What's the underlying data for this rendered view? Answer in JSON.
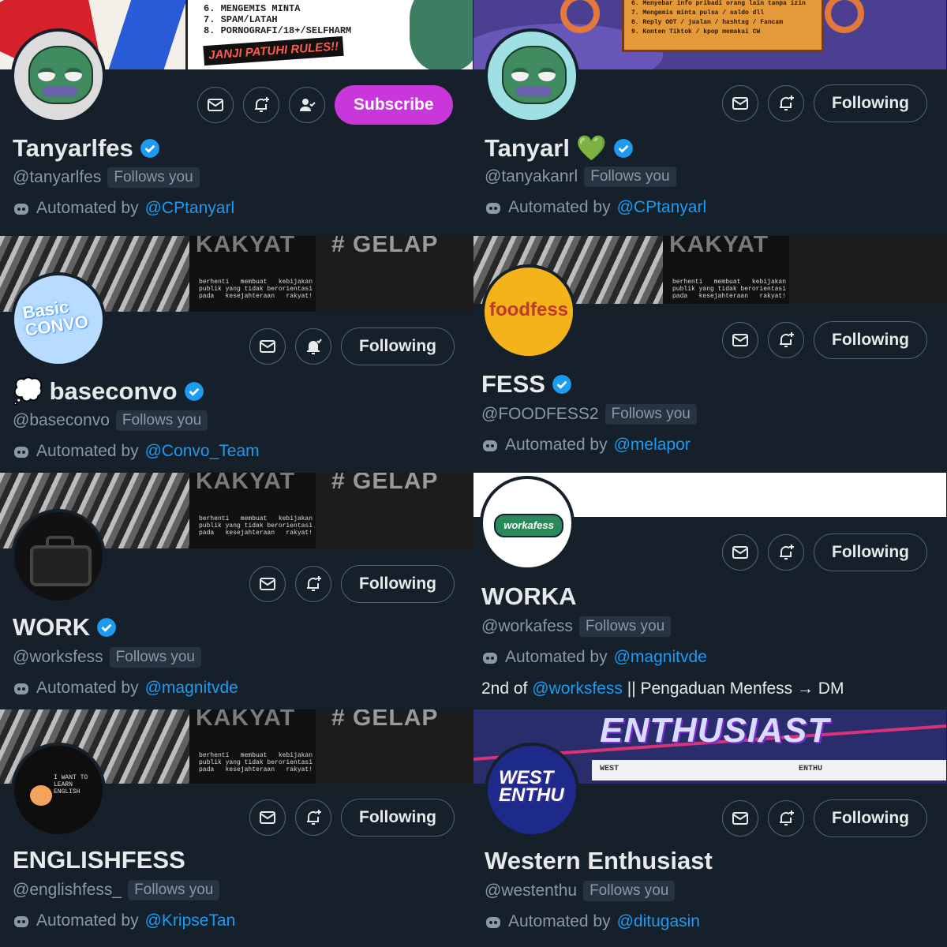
{
  "profiles": [
    {
      "display_name": "Tanyarlfes",
      "handle": "@tanyarlfes",
      "follows_you": "Follows you",
      "automated_prefix": "Automated by",
      "automated_by": "@CPtanyarl",
      "primary_button": "Subscribe",
      "verified": true
    },
    {
      "display_name": "Tanyarl",
      "name_emoji": "💚",
      "handle": "@tanyakanrl",
      "follows_you": "Follows you",
      "automated_prefix": "Automated by",
      "automated_by": "@CPtanyarl",
      "primary_button": "Following",
      "verified": true
    },
    {
      "display_name": "baseconvo",
      "name_emoji": "💭",
      "handle": "@baseconvo",
      "follows_you": "Follows you",
      "automated_prefix": "Automated by",
      "automated_by": "@Convo_Team",
      "primary_button": "Following",
      "verified": true
    },
    {
      "display_name": "FESS",
      "handle": "@FOODFESS2",
      "follows_you": "Follows you",
      "automated_prefix": "Automated by",
      "automated_by": "@melapor",
      "primary_button": "Following",
      "verified": true
    },
    {
      "display_name": "WORK",
      "handle": "@worksfess",
      "follows_you": "Follows you",
      "automated_prefix": "Automated by",
      "automated_by": "@magnitvde",
      "primary_button": "Following",
      "verified": true
    },
    {
      "display_name": "WORKA",
      "handle": "@workafess",
      "follows_you": "Follows you",
      "automated_prefix": "Automated by",
      "automated_by": "@magnitvde",
      "primary_button": "Following",
      "bio_prefix": "2nd of",
      "bio_link": "@worksfess",
      "bio_suffix": "|| Pengaduan Menfess → DM",
      "verified": false
    },
    {
      "display_name": "ENGLISHFESS",
      "handle": "@englishfess_",
      "follows_you": "Follows you",
      "automated_prefix": "Automated by",
      "automated_by": "@KripseTan",
      "primary_button": "Following",
      "verified": false
    },
    {
      "display_name": "Western Enthusiast",
      "handle": "@westenthu",
      "follows_you": "Follows you",
      "automated_prefix": "Automated by",
      "automated_by": "@ditugasin",
      "primary_button": "Following",
      "verified": false
    }
  ],
  "banners": {
    "rules": {
      "line_6": "6. MENGEMIS MINTA",
      "line_7": "7. SPAM/LATAH",
      "line_8": "8. PORNOGRAFI/18+/SELFHARM",
      "promise": "JANJI PATUHI RULES!!"
    },
    "sea": {
      "line_6": "6. Menyebar info pribadi orang lain tanpa izin",
      "line_7": "7. Mengemis minta pulsa / saldo dll",
      "line_8": "8. Reply OOT / jualan / hashtag / Fancam",
      "line_9": "9. Konten Tiktok / kpop memakai CW"
    },
    "protest": {
      "word_left": "KAKYAT",
      "word_right": "# GELAP",
      "caption": "berhenti   membuat   kebijakan\npublik yang tidak berorientasi\npada   kesejahteraan   rakyat!"
    },
    "enthusiast": {
      "title": "ENTHUSIAST",
      "left_tag": "WEST",
      "right_tag": "ENTHU"
    }
  },
  "avatars": {
    "convo": "Basic CONVO",
    "food": "foodfess",
    "worka": "workafess",
    "english": "I WANT TO LEARN ENGLISH",
    "west": "WEST ENTHU"
  },
  "colors": {
    "background": "#15202b",
    "link": "#1d9bf0",
    "verified": "#1d9bf0",
    "subscribe": "#c936d9",
    "muted": "#8b98a5"
  },
  "icons": [
    "mail-icon",
    "notification-bell-icon",
    "follow-person-icon",
    "verified-badge-icon",
    "bot-icon"
  ]
}
